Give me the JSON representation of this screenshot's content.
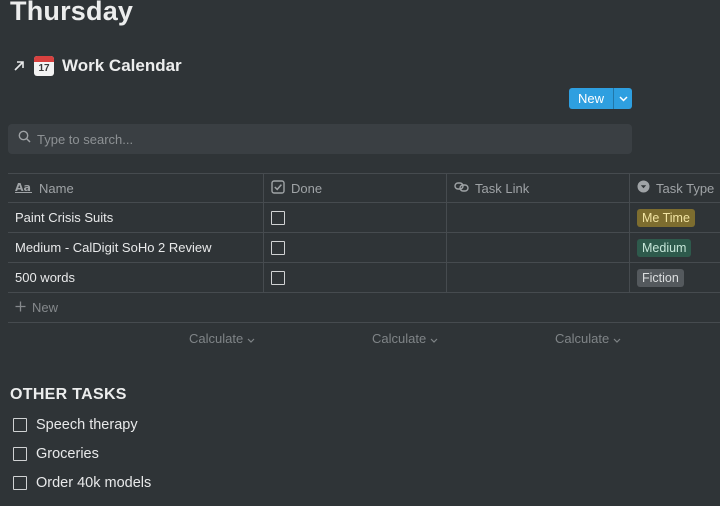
{
  "page": {
    "title": "Thursday"
  },
  "database": {
    "title": "Work Calendar",
    "calendar_icon_day": "17",
    "new_button_label": "New"
  },
  "search": {
    "placeholder": "Type to search..."
  },
  "columns": [
    {
      "label": "Name",
      "icon": "text-aa-icon"
    },
    {
      "label": "Done",
      "icon": "checkbox-icon"
    },
    {
      "label": "Task Link",
      "icon": "relation-link-icon"
    },
    {
      "label": "Task Type",
      "icon": "select-icon"
    }
  ],
  "rows": [
    {
      "name": "Paint Crisis Suits",
      "done": false,
      "task_link": "",
      "task_type": "Me Time"
    },
    {
      "name": "Medium - CalDigit SoHo 2 Review",
      "done": false,
      "task_link": "",
      "task_type": "Medium"
    },
    {
      "name": "500 words",
      "done": false,
      "task_link": "",
      "task_type": "Fiction"
    }
  ],
  "tag_colors": {
    "Me Time": {
      "bg": "#7d6d2f",
      "fg": "#f1e3a2"
    },
    "Medium": {
      "bg": "#2e5a4c",
      "fg": "#c6e6d8"
    },
    "Fiction": {
      "bg": "#54595d",
      "fg": "#dcdedf"
    }
  },
  "new_row_label": "New",
  "calculate_label": "Calculate",
  "other_tasks": {
    "title": "OTHER TASKS",
    "items": [
      {
        "label": "Speech therapy",
        "done": false
      },
      {
        "label": "Groceries",
        "done": false
      },
      {
        "label": "Order 40k models",
        "done": false
      }
    ]
  },
  "colors": {
    "background": "#2f3437",
    "accent": "#2e9fe0"
  }
}
